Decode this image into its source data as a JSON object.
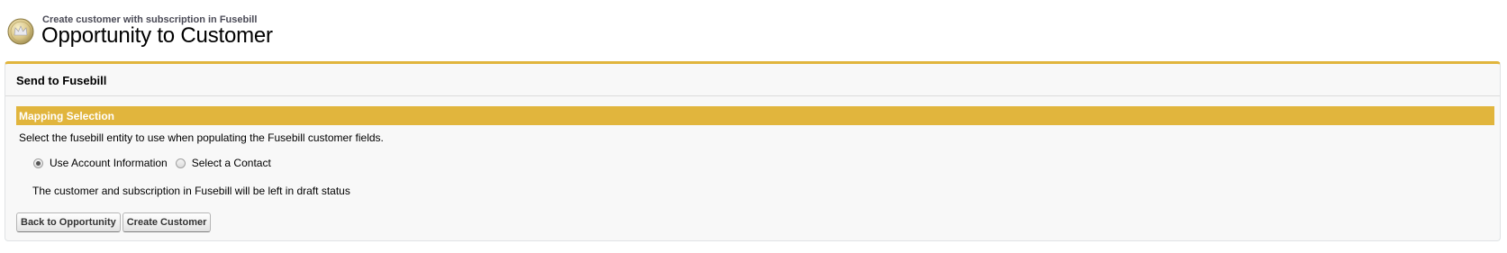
{
  "header": {
    "subtitle": "Create customer with subscription in Fusebill",
    "title": "Opportunity to Customer",
    "icon": "opportunity-crown-icon"
  },
  "panel": {
    "title": "Send to Fusebill",
    "section_title": "Mapping Selection",
    "description": "Select the fusebill entity to use when populating the Fusebill customer fields.",
    "options": [
      {
        "label": "Use Account Information",
        "selected": true
      },
      {
        "label": "Select a Contact",
        "selected": false
      }
    ],
    "note": "The customer and subscription in Fusebill will be left in draft status",
    "buttons": {
      "back_label": "Back to Opportunity",
      "create_label": "Create Customer"
    }
  },
  "colors": {
    "accent": "#e1b53d",
    "panel_bg": "#f8f8f8"
  }
}
